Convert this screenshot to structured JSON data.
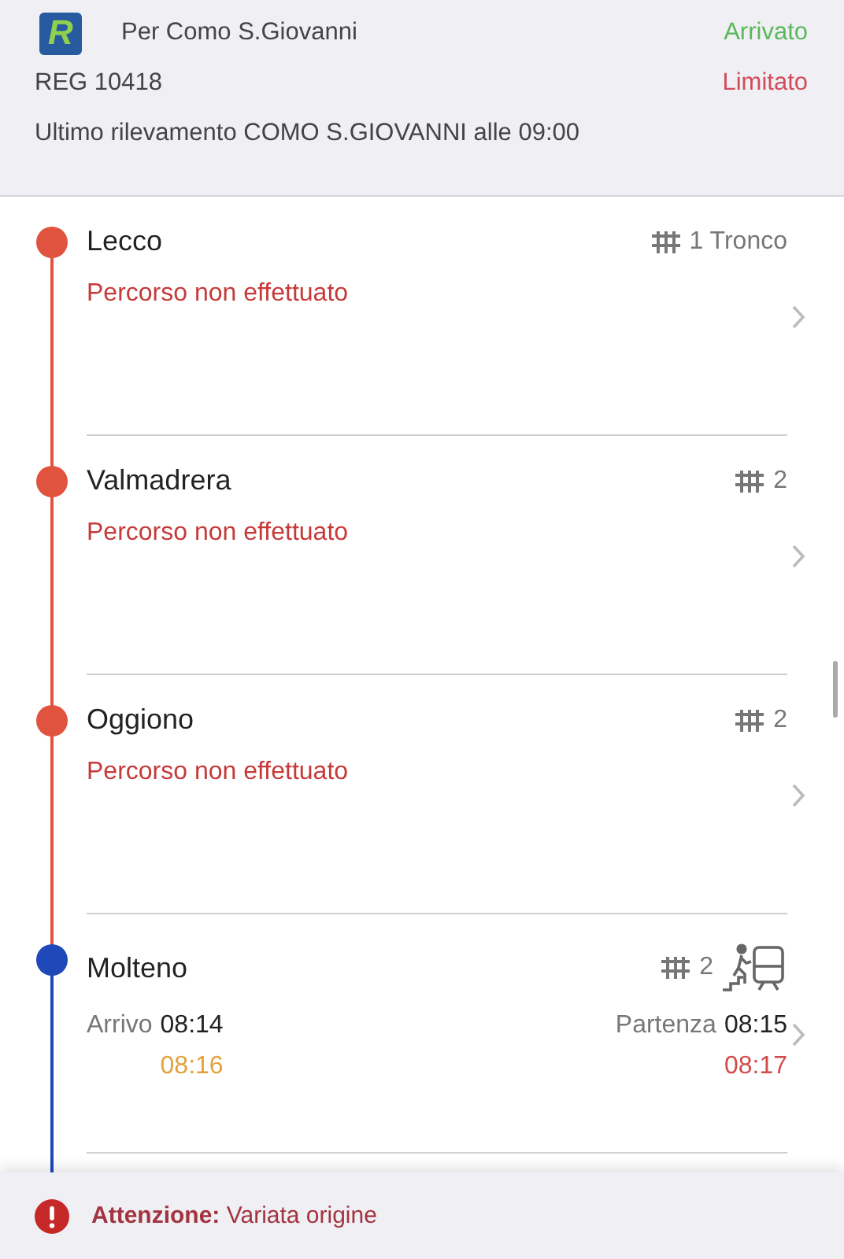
{
  "header": {
    "logo": "R",
    "destination": "Per Como S.Giovanni",
    "state": "Arrivato",
    "train": "REG 10418",
    "service": "Limitato",
    "last_seen": "Ultimo rilevamento COMO S.GIOVANNI alle 09:00"
  },
  "stops": [
    {
      "kind": "skipped",
      "name": "Lecco",
      "color": "#e0533f",
      "platform": "1 Tronco",
      "status": "Percorso non effettuato"
    },
    {
      "kind": "skipped",
      "name": "Valmadrera",
      "color": "#e0533f",
      "platform": "2",
      "status": "Percorso non effettuato"
    },
    {
      "kind": "skipped",
      "name": "Oggiono",
      "color": "#e0533f",
      "platform": "2",
      "status": "Percorso non effettuato"
    },
    {
      "kind": "served",
      "name": "Molteno",
      "color": "#1f49b8",
      "platform": "2",
      "boarding": true,
      "arrival": {
        "label": "Arrivo",
        "scheduled": "08:14",
        "actual": "08:16",
        "color": "#e3a23c"
      },
      "departure": {
        "label": "Partenza",
        "scheduled": "08:15",
        "actual": "08:17",
        "color": "#d24b4b"
      }
    }
  ],
  "alert": {
    "text": "**Attenzione:** Variata origine"
  }
}
